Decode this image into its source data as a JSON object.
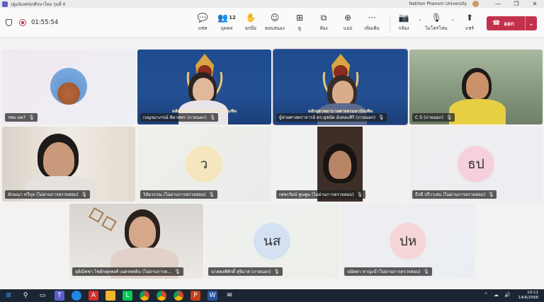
{
  "window": {
    "title": "ปฐมนิเทศนักศึกษาใหม่ รุ่นที่ 4",
    "org": "Nakhon Phanom University",
    "controls": [
      "—",
      "❐",
      "✕"
    ]
  },
  "toolbar": {
    "timer": "01:55:54",
    "buttons": [
      {
        "icon": "chat-icon",
        "glyph": "💬",
        "label": "แชท"
      },
      {
        "icon": "people-icon",
        "glyph": "👥",
        "label": "บุคคล",
        "count": "12"
      },
      {
        "icon": "raise-hand-icon",
        "glyph": "✋",
        "label": "ยกมือ"
      },
      {
        "icon": "react-icon",
        "glyph": "☺",
        "label": "ตอบสนอง"
      },
      {
        "icon": "view-icon",
        "glyph": "⊞",
        "label": "ดู"
      },
      {
        "icon": "rooms-icon",
        "glyph": "⧉",
        "label": "ห้อง"
      },
      {
        "icon": "apps-icon",
        "glyph": "⊕",
        "label": "แอป"
      },
      {
        "icon": "more-icon",
        "glyph": "···",
        "label": "เพิ่มเติม"
      },
      {
        "icon": "camera-off-icon",
        "glyph": "📷",
        "label": "กล้อง"
      },
      {
        "icon": "mic-off-icon",
        "glyph": "🎙",
        "label": "ไมโครโฟน"
      },
      {
        "icon": "share-icon",
        "glyph": "⬆",
        "label": "แชร์"
      }
    ],
    "leave_label": "ออก"
  },
  "participants": [
    {
      "name": "รพย.นพ7",
      "type": "photo"
    },
    {
      "name": "เบญจมาภรณ์ พิลาสพร (ภายนอก)",
      "type": "video",
      "banner": "หลักสูตรพยาบาลศาสตรมหาบัณฑิต"
    },
    {
      "name": "ผู้ช่วยศาสตราจารย์ ดร.ษุชนัด มังคละศิริ (ภายนอก)",
      "type": "video",
      "banner": "หลักสูตรพยาบาลศาสตรมหาบัณฑิต"
    },
    {
      "name": "C S (ภายนอก)",
      "type": "video"
    },
    {
      "name": "ลักษณา ทวีกุล (ไม่ผ่านการตรวจสอบ)",
      "type": "video"
    },
    {
      "name": "วิลัยวรรณ (ไม่ผ่านการตรวจสอบ)",
      "type": "initials",
      "initials": "ว",
      "color": "#f6e6bd"
    },
    {
      "name": "เพชรรัตน์ พูนพูน (ไม่ผ่านการตรวจสอบ)",
      "type": "video"
    },
    {
      "name": "ธีรดี ปรีวาเสน (ไม่ผ่านการตรวจสอบ)",
      "type": "initials",
      "initials": "ธป",
      "color": "#f6d0dd"
    },
    {
      "name": "จุติณิชชา ไชยักคุดพงศ์ เนตรพลดิน (ไม่ผ่านการต...",
      "type": "video"
    },
    {
      "name": "นายพงศ์ศักดิ์ สุจิมาส (ภายนอก)",
      "type": "initials",
      "initials": "นส",
      "color": "#d3e1f3"
    },
    {
      "name": "ปนัดดา หาญะมี (ไม่ผ่านการตรวจสอบ)",
      "type": "initials",
      "initials": "ปห",
      "color": "#f6d6d6"
    }
  ],
  "taskbar": {
    "time": "10:11",
    "date": "14/6/2568"
  }
}
